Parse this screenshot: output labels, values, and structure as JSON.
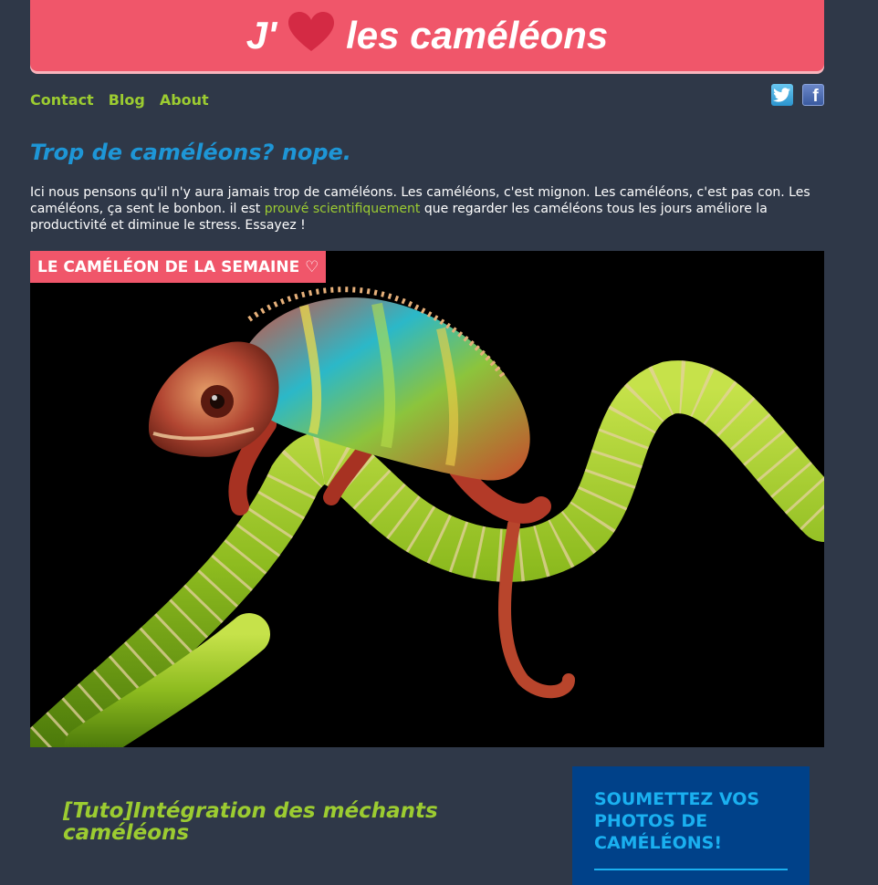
{
  "header": {
    "title_prefix": "J'",
    "title_suffix": "les caméléons",
    "heart_icon": "heart-icon",
    "banner_color": "#f0566a"
  },
  "nav": {
    "items": [
      {
        "label": "Contact"
      },
      {
        "label": "Blog"
      },
      {
        "label": "About"
      }
    ],
    "link_color": "#9ccc31"
  },
  "social": {
    "twitter_icon": "twitter-icon",
    "facebook_icon": "facebook-icon",
    "facebook_letter": "f"
  },
  "intro": {
    "title": "Trop de caméléons? nope.",
    "text_before": "Ici nous pensons qu'il n'y aura jamais trop de caméléons. Les caméléons, c'est mignon. Les caméléons, c'est pas con. Les caméléons, ça sent le bonbon. il est ",
    "link_text": "prouvé scientifiquement",
    "text_after": " que regarder les caméléons tous les jours améliore la productivité et diminue le stress. Essayez !"
  },
  "feature": {
    "tag": "LE CAMÉLÉON DE LA SEMAINE ♡"
  },
  "post": {
    "title": "[Tuto]Intégration des méchants caméléons"
  },
  "sidebar": {
    "title": "SOUMETTEZ VOS PHOTOS DE CAMÉLÉONS!",
    "accent_color": "#1ab0f0",
    "background_color": "#004189"
  }
}
